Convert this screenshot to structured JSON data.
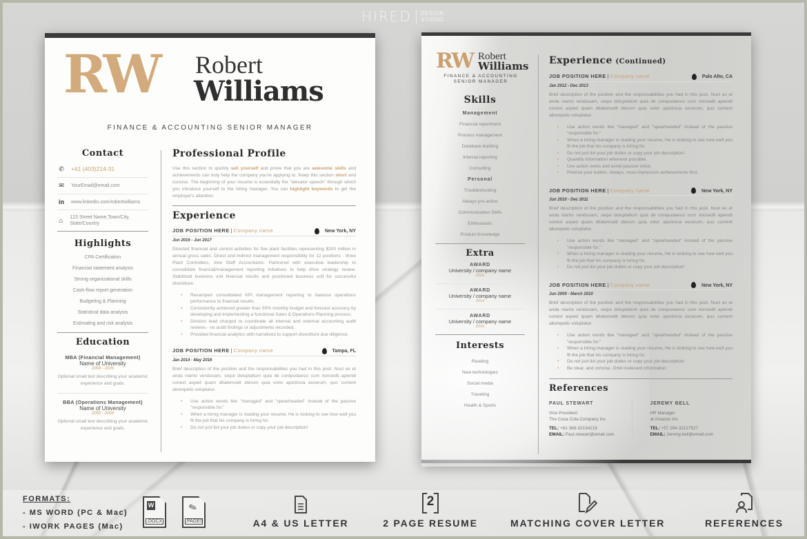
{
  "brand": {
    "name": "HIRED",
    "sub": "DESIGN STUDIO"
  },
  "resume": {
    "initials": "RW",
    "first_name": "Robert",
    "last_name": "Williams",
    "title": "FINANCE & ACCOUNTING SENIOR MANAGER",
    "title_line1": "FINANCE & ACCOUNTING",
    "title_line2": "SENIOR MANAGER",
    "accent_color": "#d2aa7b"
  },
  "page1": {
    "contact": {
      "heading": "Contact",
      "phone": "+61 (403)214-31",
      "email": "YourEmail@email.com",
      "linkedin": "www.linkedin.com/robertwilliams",
      "address": "123 Street Name,Town/City, State/Country"
    },
    "highlights": {
      "heading": "Highlights",
      "items": [
        "CPA Certification",
        "Financial statement analysis",
        "Strong organizational skills",
        "Cash-flow report generation",
        "Budgeting & Planning",
        "Statistical data analysis",
        "Estimating and risk analysis"
      ]
    },
    "education": {
      "heading": "Education",
      "items": [
        {
          "degree": "MBA (Financial Management)",
          "school": "Name of University",
          "years": "2004 - 2006",
          "desc": "Optional small text describing your academic experience and goals."
        },
        {
          "degree": "BBA (Operations Management)",
          "school": "Name of University",
          "years": "2000 - 2004",
          "desc": "Optional small text describing your academic experience and goals."
        }
      ]
    },
    "profile": {
      "heading": "Professional Profile",
      "t1": "Use this section to quickly ",
      "h1": "sell yourself",
      "t2": " and prove that you are ",
      "h2": "awesome skills",
      "t3": " and achievements can truly help the company you're applying to. Keep this section ",
      "h3": "short",
      "t4": " and concise. The beginning of your resume is essentially the \"elevator speech\" through which you introduce yourself to the hiring manager. You can ",
      "h4": "highlight keywords",
      "t5": " to get the employer's attention."
    },
    "experience": {
      "heading": "Experience",
      "jobs": [
        {
          "position": "JOB POSITION HERE",
          "company": "Company name",
          "location": "New York, NY",
          "dates": "Jun 2016 - Jun 2017",
          "desc": "Directed financial and control activities for five plant facilities representing $200 million in annual gross sales. Direct and indirect management responsibility for 12 positions - three Plant Controllers, nine Staff Accountants. Partnered with executive leadership to consolidate financial/management reporting initiatives to help drive strategy review. Stabilized business unit financial results and positioned business unit for successful divestiture.",
          "bullets": [
            "Revamped consolidated KPI management reporting to balance operations performance to financial results.",
            "Consistently achieved greater than 90% monthly budget and forecast accuracy by developing and implementing a functional Sales & Operations Planning process.",
            "Division lead charged to coordinate all internal and external accounting audit reviews - no audit findings or adjustments recorded.",
            "Provided financial analytics with narratives to support divestiture due diligence."
          ]
        },
        {
          "position": "JOB POSITION HERE",
          "company": "Company name",
          "location": "Tampa, FL",
          "dates": "Jan 2014 - May 2016",
          "desc": "Brief description of the position and the responsabilities you had in this post. Nust ex et anda nianto vendusam, sequi doluptatium quia de corepudaesci cum nonsedit apiendi conest asped quam ditatemodit iderum quia volor apictincia excerum, quo cument aborepelis voluptatur.",
          "bullets": [
            "Use action words like \"managed\" and \"spearheaded\" instead of the passive \"responsible for.\"",
            "When a hiring manager is reading your resume, He is looking to see how well you fit the job that his company is hiring for.",
            "Do not just list your job duties or copy your job description!"
          ]
        }
      ]
    }
  },
  "page2": {
    "skills": {
      "heading": "Skills",
      "management_label": "Management",
      "management": [
        "Financial reportment",
        "Process management",
        "Database building",
        "Internal reporting",
        "Consulting"
      ],
      "personal_label": "Personal",
      "personal": [
        "Troubleshooting",
        "Always pro-active",
        "Communication Skills",
        "Enthusiastic",
        "Product Knowledge"
      ]
    },
    "extra": {
      "heading": "Extra",
      "awards": [
        {
          "label": "AWARD",
          "name": "University / company name",
          "year": "2016"
        },
        {
          "label": "AWARD",
          "name": "University / company name",
          "year": "2014"
        },
        {
          "label": "AWARD",
          "name": "University / company name",
          "year": "2010"
        }
      ]
    },
    "interests": {
      "heading": "Interests",
      "items": [
        "Reading",
        "New technologies",
        "Social media",
        "Traveling",
        "Health & Sports"
      ]
    },
    "experience": {
      "heading": "Experience",
      "heading_sub": "(Continued)",
      "jobs": [
        {
          "position": "JOB POSITION HERE",
          "company": "Company name",
          "location": "Palo Alto, CA",
          "dates": "Jan 2012 - Dec 2013",
          "desc": "Brief description of the position and the responsabilities you had in this post. Nust ex et anda nianto vendusam, sequi doluptatium quia de corepudaesci cum nonsedit apiendi conest asped quam ditatemodit iderum quia volor apictincia excerum, quo cument aborepelis voluptatur.",
          "bullets": [
            "Use action words like \"managed\" and \"spearheaded\" instead of the passive \"responsible for.\"",
            "When a hiring manager is reading your resume, He is looking to see how well you fit the job that his company is hiring for.",
            "Do not just list your job duties or copy your job description!",
            "Quantify information wherever possible.",
            "Use action verbs and avoid passive voice.",
            "Prioriza your bullets: Always, most impressive achievements first."
          ]
        },
        {
          "position": "JOB POSITION HERE",
          "company": "Company name",
          "location": "New York, NY",
          "dates": "Jun 2010 - Dec 2011",
          "desc": "Brief description of the position and the responsabilities you had in this post. Nust ex et anda nianto vendusam, sequi doluptatium quia de corepudaesci cum nonsedit apiendi conest asped quam ditatemodit iderum quia volor apictincia excerum, quo cument aborepelis voluptatur.",
          "bullets": [
            "Use action words like \"managed\" and \"spearheaded\" instead of the passive \"responsible for.\"",
            "When a hiring manager is reading your resume, He is looking to see how well you fit the job that his company is hiring for.",
            "Do not just list your job duties or copy your job description!"
          ]
        },
        {
          "position": "JOB POSITION HERE",
          "company": "Company name",
          "location": "New York, NY",
          "dates": "Jun 2009 - March 2010",
          "desc": "Brief description of the position and the responsabilities you had in this post. Nust ex et anda nianto vendusam, sequi doluptatium quia de corepudaesci cum nonsedit apiendi conest asped quam ditatemodit iderum quia volor apictincia excerum, quo cument aborepelis voluptatur.",
          "bullets": [
            "Use action words like \"managed\" and \"spearheaded\" instead of the passive \"responsible for.\"",
            "When a hiring manager is reading your resume, He is looking to see how well you fit the job that his company is hiring for.",
            "Do not just list your job duties or copy your job description!",
            "Be clear, and concise. Omit irrelevant information."
          ]
        }
      ]
    },
    "references": {
      "heading": "References",
      "people": [
        {
          "name": "PAUL STEWART",
          "role": "Vice President",
          "org": "The Coca Cola Company Inc",
          "tel_label": "TEL:",
          "tel": "+61 368-32134218",
          "email_label": "EMAIL:",
          "email": "Paul.stewart@email.com"
        },
        {
          "name": "JEREMY BELL",
          "role": "HR Manager",
          "org": "at Amazon Inc",
          "tel_label": "TEL:",
          "tel": "+57 294-32127527",
          "email_label": "EMAIL:",
          "email": "Jeremy.bell@email.com"
        }
      ]
    }
  },
  "footer": {
    "formats_heading": "FORMATS:",
    "formats": [
      "- MS WORD (PC & Mac)",
      "- IWORK PAGES (Mac)"
    ],
    "docx_label": ".DOCX",
    "pages_label": ".PAGES",
    "features": [
      {
        "icon": "document-icon",
        "label": "A4 & US LETTER"
      },
      {
        "icon": "two-page-icon",
        "label": "2 PAGE RESUME",
        "glyph": "2"
      },
      {
        "icon": "cover-letter-icon",
        "label": "MATCHING COVER LETTER"
      },
      {
        "icon": "references-icon",
        "label": "REFERENCES"
      }
    ]
  }
}
